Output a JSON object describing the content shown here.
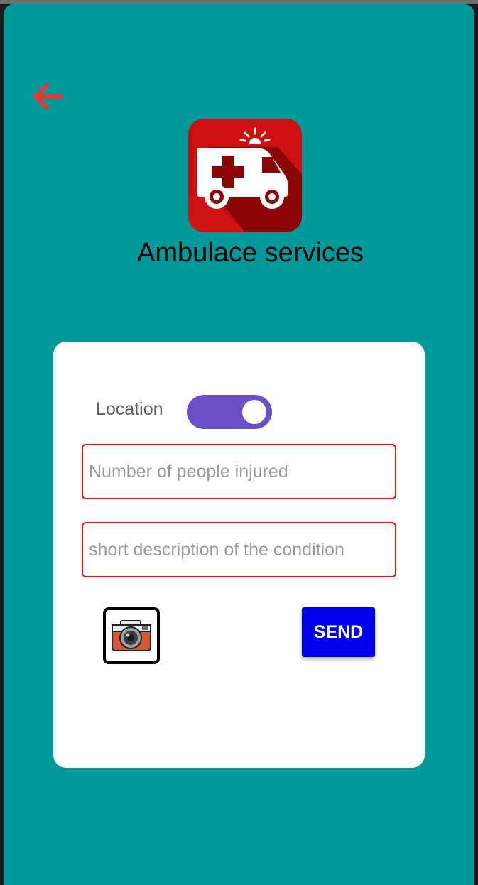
{
  "header": {
    "title": "Ambulace services",
    "back_icon": "arrow-left-icon",
    "logo_icon": "ambulance-icon"
  },
  "form": {
    "location_label": "Location",
    "location_enabled": true,
    "injured_placeholder": "Number of people injured",
    "injured_value": "",
    "description_placeholder": "short description of the condition",
    "description_value": "",
    "camera_icon": "camera-icon",
    "send_label": "SEND"
  },
  "colors": {
    "background": "#009999",
    "card": "#ffffff",
    "accent_back": "#e53935",
    "toggle": "#6a51c8",
    "field_border": "#e81515",
    "send_button": "#0000ee"
  }
}
